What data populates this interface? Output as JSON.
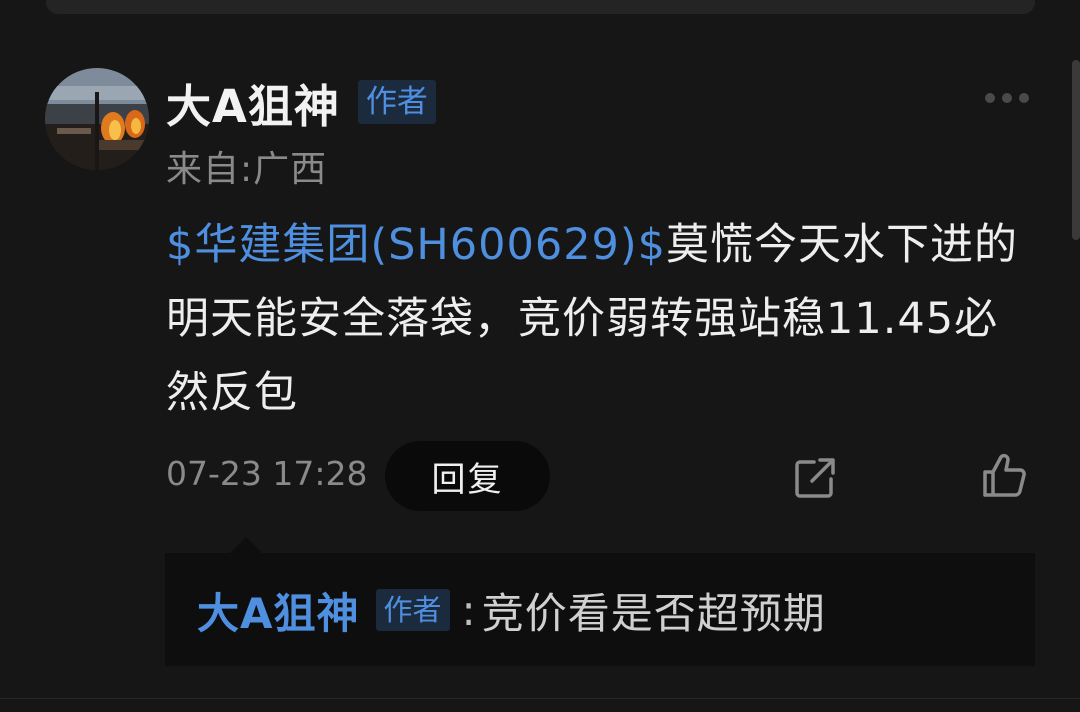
{
  "post": {
    "author": "大A狙神",
    "author_badge": "作者",
    "location": "来自:广西",
    "stock_link": "$华建集团(SH600629)$",
    "content_text": "莫慌今天水下进的明天能安全落袋，竞价弱转强站稳11.45必然反包",
    "timestamp": "07-23 17:28",
    "reply_label": "回复"
  },
  "reply": {
    "author": "大A狙神",
    "author_badge": "作者",
    "colon": ":",
    "text": "竞价看是否超预期"
  },
  "icons": {
    "more": "more-horizontal-icon",
    "share": "share-icon",
    "like": "thumbs-up-icon"
  },
  "colors": {
    "background": "#161616",
    "accent": "#4f8fe0",
    "badge_bg": "#1c2a3e",
    "muted": "#8a8a8a"
  }
}
